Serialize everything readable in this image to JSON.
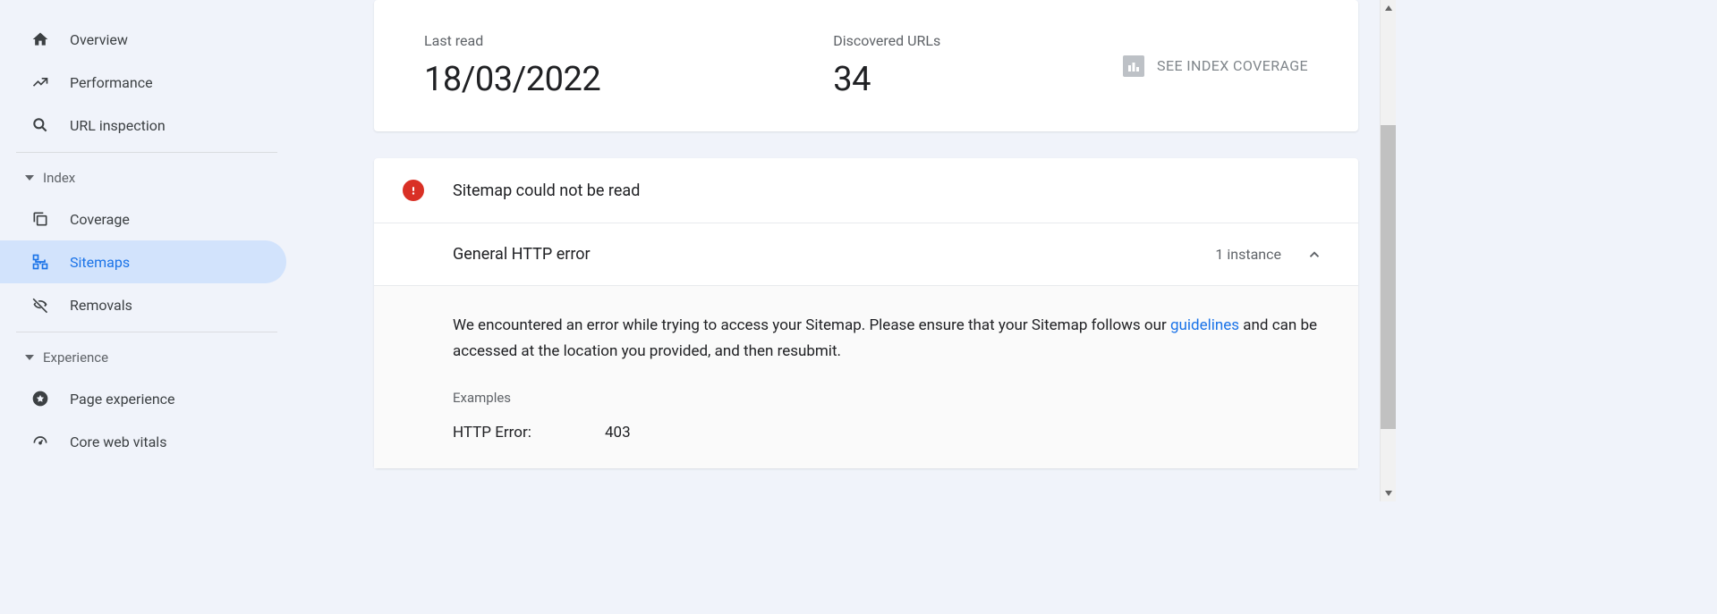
{
  "sidebar": {
    "items": [
      {
        "label": "Overview"
      },
      {
        "label": "Performance"
      },
      {
        "label": "URL inspection"
      }
    ],
    "groups": {
      "index": {
        "label": "Index",
        "items": [
          {
            "label": "Coverage"
          },
          {
            "label": "Sitemaps"
          },
          {
            "label": "Removals"
          }
        ]
      },
      "experience": {
        "label": "Experience",
        "items": [
          {
            "label": "Page experience"
          },
          {
            "label": "Core web vitals"
          }
        ]
      }
    }
  },
  "stats": {
    "last_read_label": "Last read",
    "last_read_value": "18/03/2022",
    "discovered_label": "Discovered URLs",
    "discovered_value": "34",
    "coverage_link": "SEE INDEX COVERAGE"
  },
  "error": {
    "title": "Sitemap could not be read",
    "row_title": "General HTTP error",
    "instance_count": "1 instance",
    "detail_text_1": "We encountered an error while trying to access your Sitemap. Please ensure that your Sitemap follows our ",
    "guidelines_link": "guidelines",
    "detail_text_2": " and can be accessed at the location you provided, and then resubmit.",
    "examples_label": "Examples",
    "example_key": "HTTP Error:",
    "example_value": "403"
  }
}
